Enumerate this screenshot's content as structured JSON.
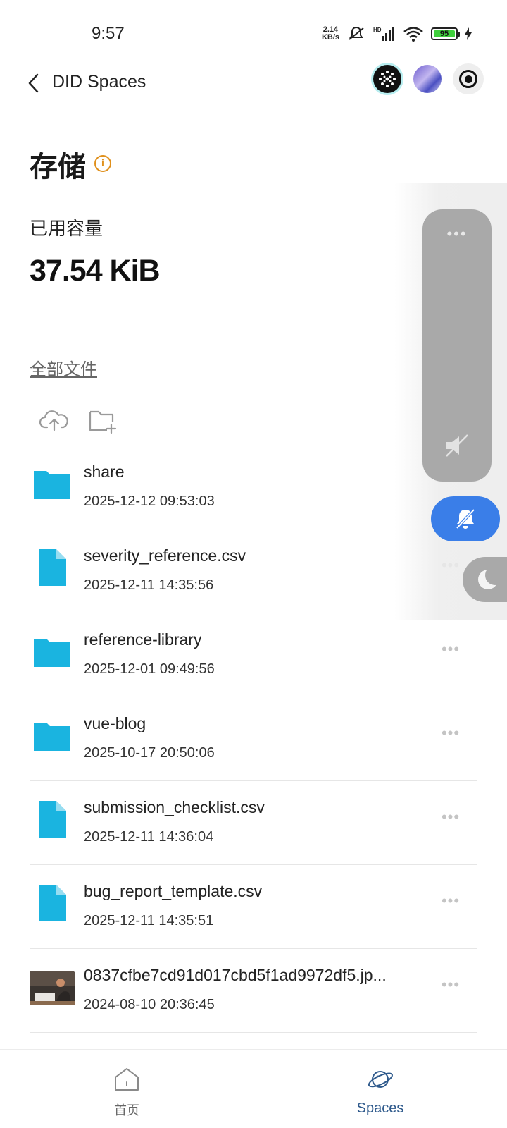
{
  "status_bar": {
    "time": "9:57",
    "net_speed_value": "2.14",
    "net_speed_unit": "KB/s",
    "battery": "95"
  },
  "header": {
    "title": "DID Spaces"
  },
  "storage": {
    "title": "存储",
    "used_label": "已用容量",
    "used_value": "37.54 KiB"
  },
  "breadcrumb": "全部文件",
  "files": [
    {
      "name": "share",
      "date": "2025-12-12 09:53:03",
      "type": "folder"
    },
    {
      "name": "severity_reference.csv",
      "date": "2025-12-11 14:35:56",
      "type": "file"
    },
    {
      "name": "reference-library",
      "date": "2025-12-01 09:49:56",
      "type": "folder"
    },
    {
      "name": "vue-blog",
      "date": "2025-10-17 20:50:06",
      "type": "folder"
    },
    {
      "name": "submission_checklist.csv",
      "date": "2025-12-11 14:36:04",
      "type": "file"
    },
    {
      "name": "bug_report_template.csv",
      "date": "2025-12-11 14:35:51",
      "type": "file"
    },
    {
      "name": "0837cfbe7cd91d017cbd5f1ad9972df5.jp...",
      "date": "2024-08-10 20:36:45",
      "type": "image"
    }
  ],
  "more_glyph": "•••",
  "bottom_nav": {
    "home_label": "首页",
    "spaces_label": "Spaces"
  },
  "colors": {
    "accent_file": "#1ab4e0",
    "accent_blue": "#3a7ee8",
    "info_orange": "#e0901c",
    "nav_active": "#2f5a8c"
  }
}
